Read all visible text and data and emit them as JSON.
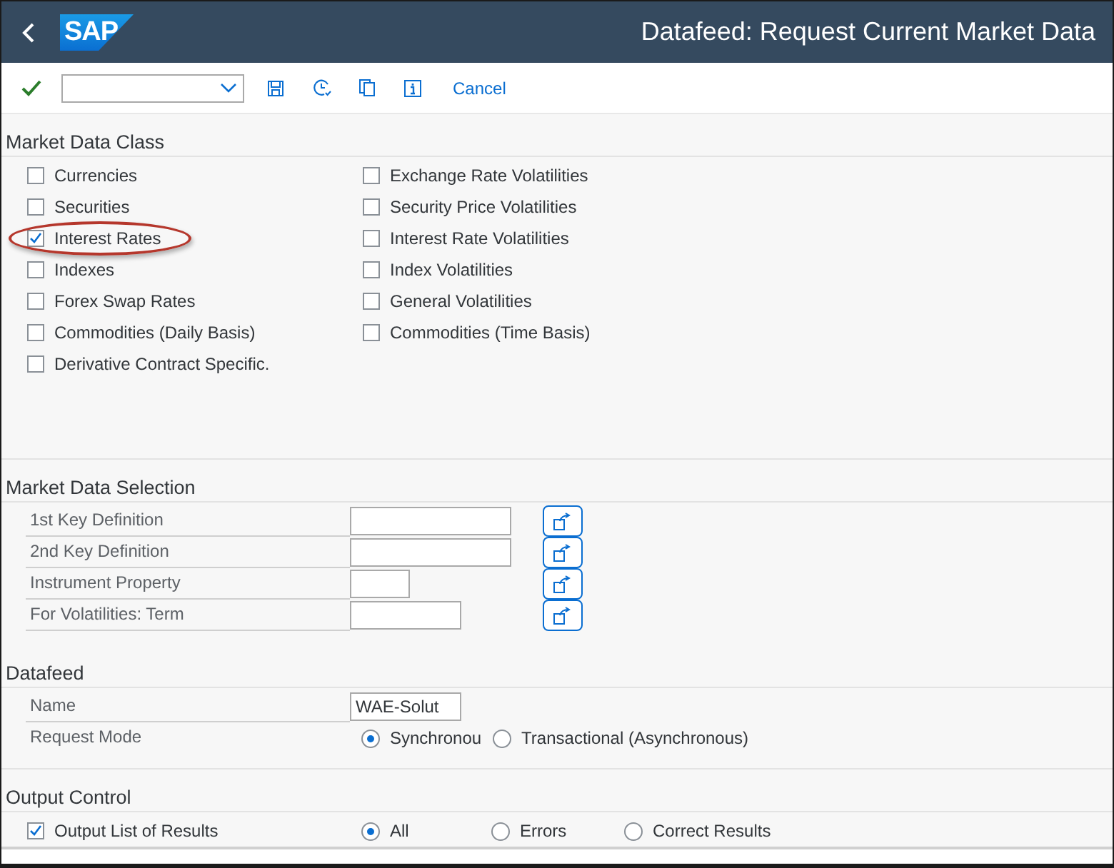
{
  "header": {
    "logo": "SAP",
    "title": "Datafeed: Request Current Market Data"
  },
  "toolbar": {
    "cancel": "Cancel"
  },
  "market_data_class": {
    "title": "Market Data Class",
    "columns": [
      [
        {
          "label": "Currencies",
          "checked": false,
          "highlighted": false
        },
        {
          "label": "Securities",
          "checked": false,
          "highlighted": false
        },
        {
          "label": "Interest Rates",
          "checked": true,
          "highlighted": true
        },
        {
          "label": "Indexes",
          "checked": false,
          "highlighted": false
        },
        {
          "label": "Forex Swap Rates",
          "checked": false,
          "highlighted": false
        },
        {
          "label": "Commodities (Daily Basis)",
          "checked": false,
          "highlighted": false
        },
        {
          "label": "Derivative Contract Specific.",
          "checked": false,
          "highlighted": false
        }
      ],
      [
        {
          "label": "Exchange Rate Volatilities",
          "checked": false,
          "highlighted": false
        },
        {
          "label": "Security Price Volatilities",
          "checked": false,
          "highlighted": false
        },
        {
          "label": "Interest Rate Volatilities",
          "checked": false,
          "highlighted": false
        },
        {
          "label": "Index Volatilities",
          "checked": false,
          "highlighted": false
        },
        {
          "label": "General Volatilities",
          "checked": false,
          "highlighted": false
        },
        {
          "label": "Commodities (Time Basis)",
          "checked": false,
          "highlighted": false
        }
      ]
    ]
  },
  "market_data_selection": {
    "title": "Market Data Selection",
    "fields": [
      {
        "label": "1st Key Definition"
      },
      {
        "label": "2nd Key Definition"
      },
      {
        "label": "Instrument Property"
      },
      {
        "label": "For Volatilities: Term"
      }
    ]
  },
  "datafeed": {
    "title": "Datafeed",
    "name": {
      "label": "Name",
      "value": "WAE-Solut"
    },
    "request_mode": {
      "label": "Request Mode",
      "options": [
        {
          "label": "Synchronou",
          "selected": true
        },
        {
          "label": "Transactional (Asynchronous)",
          "selected": false
        }
      ]
    }
  },
  "output_control": {
    "title": "Output Control",
    "output_list": {
      "label": "Output List of Results",
      "checked": true
    },
    "options": [
      {
        "label": "All",
        "selected": true
      },
      {
        "label": "Errors",
        "selected": false
      },
      {
        "label": "Correct Results",
        "selected": false
      }
    ]
  }
}
